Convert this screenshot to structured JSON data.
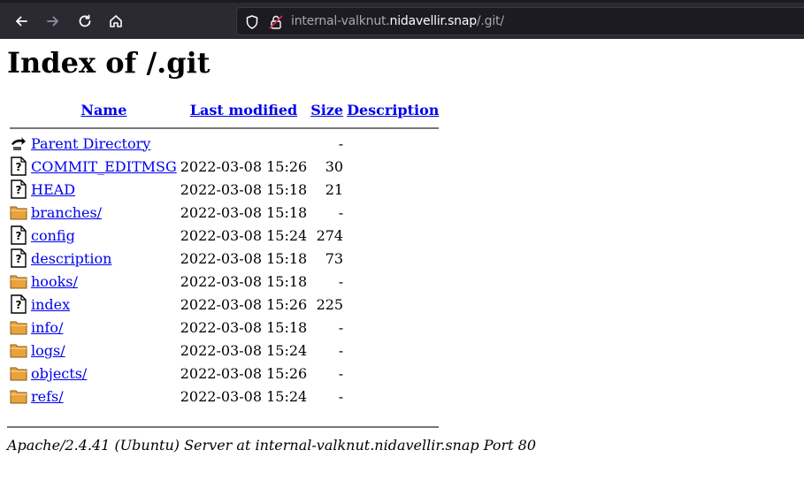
{
  "browser": {
    "url_prefix": "internal-valknut.",
    "url_host": "nidavellir.snap",
    "url_path": "/.git/"
  },
  "page": {
    "title": "Index of /.git"
  },
  "table": {
    "headers": {
      "name": "Name",
      "last_modified": "Last modified",
      "size": "Size",
      "description": "Description"
    },
    "rows": [
      {
        "icon": "back-icon",
        "name": "Parent Directory",
        "modified": "",
        "size": "-"
      },
      {
        "icon": "unknown-file-icon",
        "name": "COMMIT_EDITMSG",
        "modified": "2022-03-08 15:26",
        "size": "30"
      },
      {
        "icon": "unknown-file-icon",
        "name": "HEAD",
        "modified": "2022-03-08 15:18",
        "size": "21"
      },
      {
        "icon": "folder-icon",
        "name": "branches/",
        "modified": "2022-03-08 15:18",
        "size": "-"
      },
      {
        "icon": "unknown-file-icon",
        "name": "config",
        "modified": "2022-03-08 15:24",
        "size": "274"
      },
      {
        "icon": "unknown-file-icon",
        "name": "description",
        "modified": "2022-03-08 15:18",
        "size": "73"
      },
      {
        "icon": "folder-icon",
        "name": "hooks/",
        "modified": "2022-03-08 15:18",
        "size": "-"
      },
      {
        "icon": "unknown-file-icon",
        "name": "index",
        "modified": "2022-03-08 15:26",
        "size": "225"
      },
      {
        "icon": "folder-icon",
        "name": "info/",
        "modified": "2022-03-08 15:18",
        "size": "-"
      },
      {
        "icon": "folder-icon",
        "name": "logs/",
        "modified": "2022-03-08 15:24",
        "size": "-"
      },
      {
        "icon": "folder-icon",
        "name": "objects/",
        "modified": "2022-03-08 15:26",
        "size": "-"
      },
      {
        "icon": "folder-icon",
        "name": "refs/",
        "modified": "2022-03-08 15:24",
        "size": "-"
      }
    ]
  },
  "footer": {
    "server": "Apache/2.4.41 (Ubuntu) Server at internal-valknut.nidavellir.snap Port 80"
  },
  "colors": {
    "toolbar_bg": "#2b2a33",
    "link": "#0000ee",
    "folder": "#e8a33d"
  }
}
